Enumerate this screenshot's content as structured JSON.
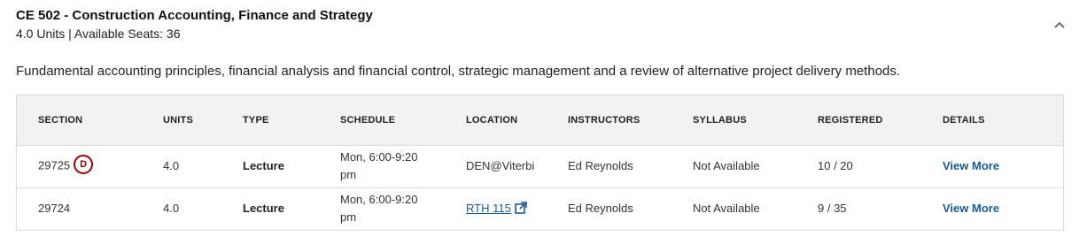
{
  "course": {
    "title": "CE 502 - Construction Accounting, Finance and Strategy",
    "meta": "4.0 Units | Available Seats: 36",
    "description": "Fundamental accounting principles, financial analysis and financial control, strategic management and a review of alternative project delivery methods."
  },
  "table": {
    "headers": {
      "section": "SECTION",
      "units": "UNITS",
      "type": "TYPE",
      "schedule": "SCHEDULE",
      "location": "LOCATION",
      "instructors": "INSTRUCTORS",
      "syllabus": "SYLLABUS",
      "registered": "REGISTERED",
      "details": "DETAILS"
    },
    "rows": [
      {
        "section": "29725",
        "badge": "D",
        "units": "4.0",
        "type": "Lecture",
        "schedule_line1": "Mon, 6:00-9:20",
        "schedule_line2": "pm",
        "location": "DEN@Viterbi",
        "instructors": "Ed Reynolds",
        "syllabus": "Not Available",
        "registered": "10 / 20",
        "details": "View More"
      },
      {
        "section": "29724",
        "units": "4.0",
        "type": "Lecture",
        "schedule_line1": "Mon, 6:00-9:20",
        "schedule_line2": "pm",
        "location": "RTH 115",
        "instructors": "Ed Reynolds",
        "syllabus": "Not Available",
        "registered": "9 / 35",
        "details": "View More"
      }
    ]
  },
  "icons": {
    "collapse": "chevron-up-icon",
    "external_link": "external-link-icon",
    "badge": "d-clearance-badge"
  },
  "colors": {
    "brand_red": "#990000",
    "link_blue": "#1a5a99",
    "header_bg": "#f2f2f2"
  }
}
